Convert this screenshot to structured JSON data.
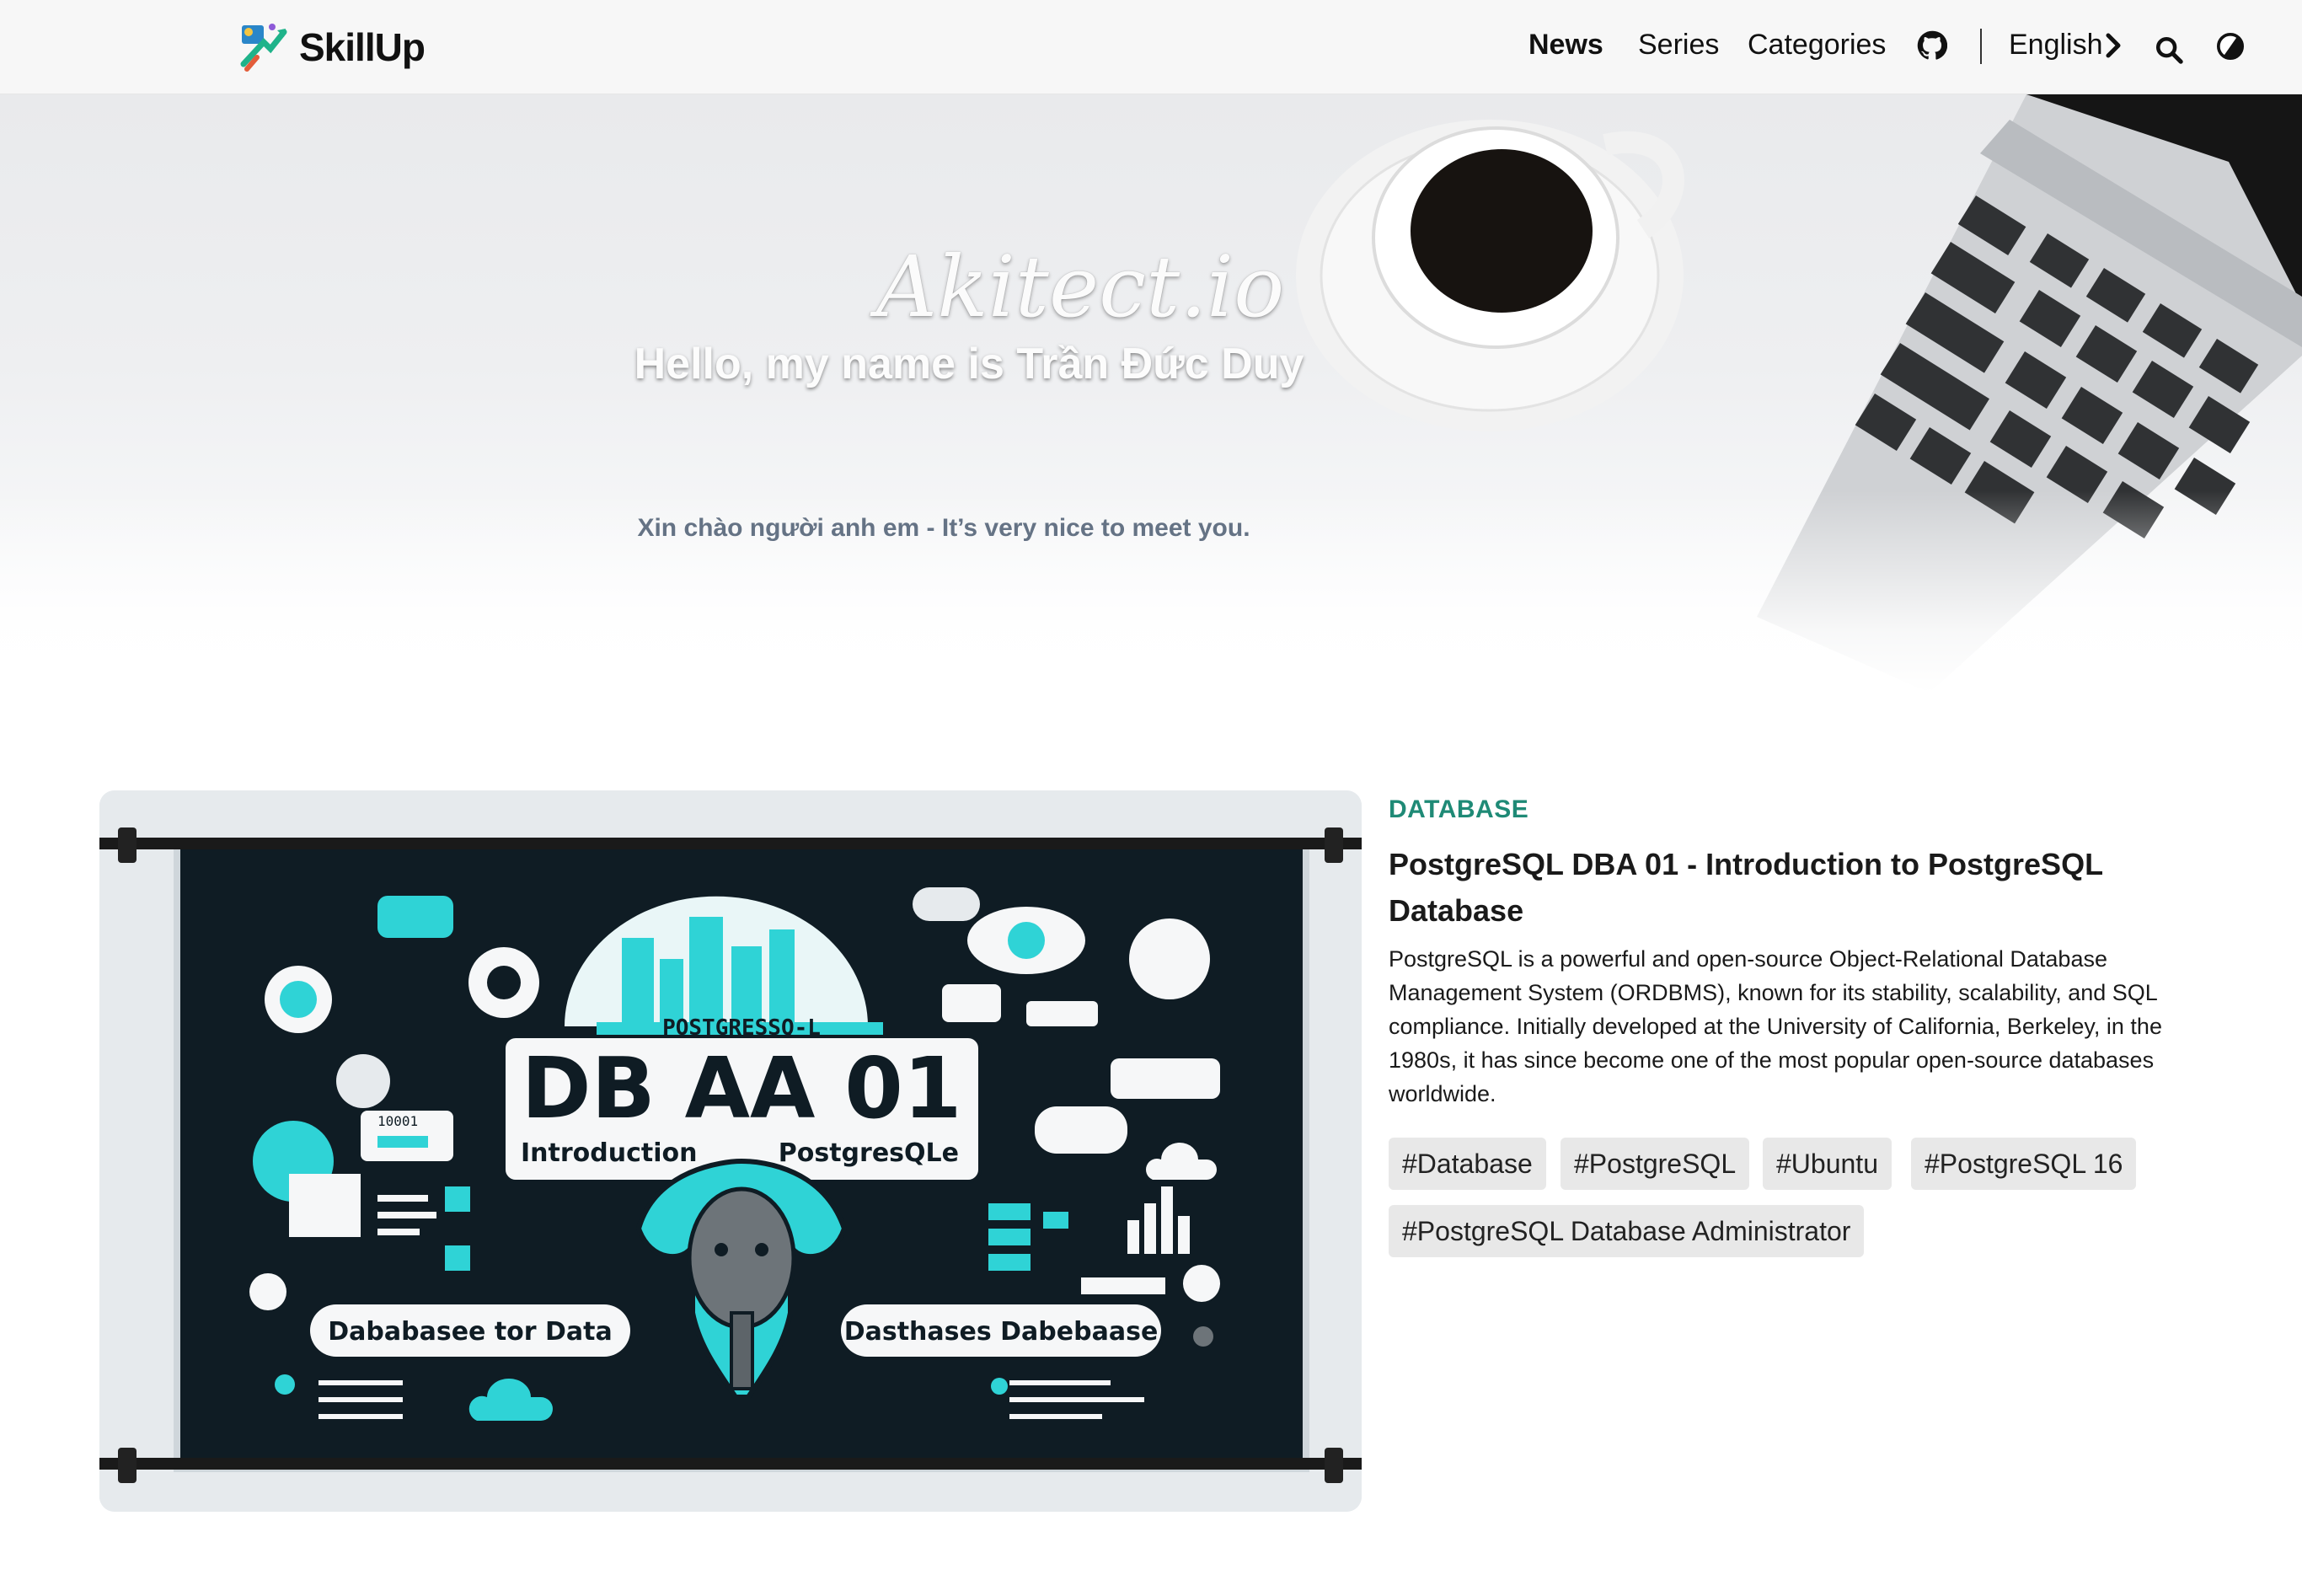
{
  "brand": {
    "name": "SkillUp"
  },
  "nav": {
    "items": [
      {
        "label": "News",
        "active": true
      },
      {
        "label": "Series",
        "active": false
      },
      {
        "label": "Categories",
        "active": false
      }
    ],
    "language_label": "English",
    "icons": [
      "github-icon",
      "chevron-right-icon",
      "search-icon",
      "theme-toggle-icon"
    ]
  },
  "hero": {
    "logo_text": "Akitect.io",
    "title": "Hello, my name is Trần Đức Duy",
    "subtitle": "Xin chào người anh em - It’s very nice to meet you."
  },
  "post": {
    "category": "DATABASE",
    "title": "PostgreSQL DBA 01 - Introduction to PostgreSQL Database",
    "excerpt": "PostgreSQL is a powerful and open-source Object-Relational Database Management System (ORDBMS), known for its stability, scalability, and SQL compliance. Initially developed at the University of California, Berkeley, in the 1980s, it has since become one of the most popular open-source databases worldwide.",
    "tags": [
      "#Database",
      "#PostgreSQL",
      "#Ubuntu",
      "#PostgreSQL 16",
      "#PostgreSQL Database Administrator"
    ],
    "image": {
      "banner_label": "POSTGRESSQ-L",
      "headline": "DB AA 01",
      "line_left": "Introduction",
      "line_right": "PostgresQLe",
      "pill_left": "Dababasee tor Data",
      "pill_right": "Dasthases Dabebaase",
      "binary": "10001"
    }
  },
  "colors": {
    "accent": "#1f8a76",
    "teal": "#2fd3d6",
    "navy": "#0e1a22"
  }
}
